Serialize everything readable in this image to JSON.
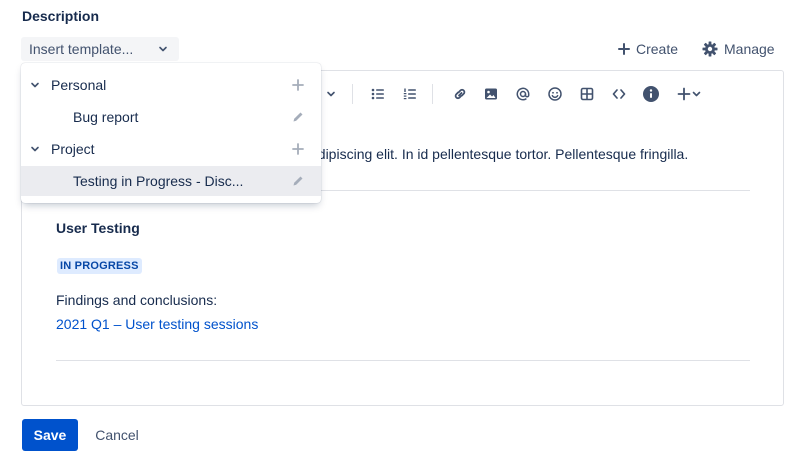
{
  "description_label": "Description",
  "template_picker": {
    "label": "Insert template..."
  },
  "actions": {
    "create": "Create",
    "manage": "Manage"
  },
  "toolbar": {
    "icons": [
      "chevron-down-icon",
      "bullet-list-icon",
      "numbered-list-icon",
      "link-icon",
      "image-icon",
      "mention-icon",
      "emoji-icon",
      "table-icon",
      "code-icon",
      "info-icon",
      "insert-plus-icon"
    ]
  },
  "content": {
    "body_text": "adipiscing elit. In id pellentesque tortor. Pellentesque fringilla.",
    "panel_title": "User Testing",
    "status_lozenge": "IN PROGRESS",
    "findings_label": "Findings and conclusions:",
    "link_text": "2021 Q1 – User testing sessions"
  },
  "dropdown": {
    "groups": [
      {
        "name": "Personal",
        "items": [
          "Bug report"
        ]
      },
      {
        "name": "Project",
        "items": [
          "Testing in Progress - Disc..."
        ]
      }
    ]
  },
  "footer": {
    "save": "Save",
    "cancel": "Cancel"
  },
  "colors": {
    "primary": "#0052cc",
    "lozenge_bg": "#deebff",
    "lozenge_text": "#0747a6",
    "text": "#172b4d",
    "subtle": "#42526e"
  }
}
